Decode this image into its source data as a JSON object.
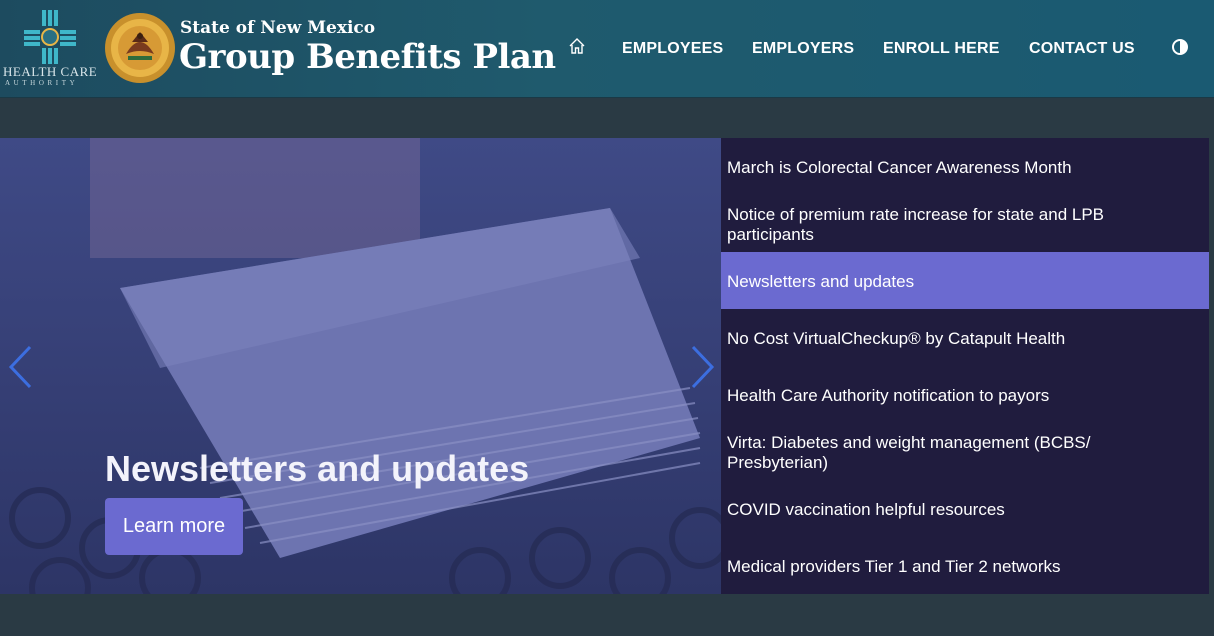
{
  "header": {
    "hca_line1": "HEALTH CARE",
    "hca_line2": "AUTHORITY",
    "title_small": "State of New Mexico",
    "title_big": "Group Benefits Plan",
    "nav": [
      {
        "label": "EMPLOYEES"
      },
      {
        "label": "EMPLOYERS"
      },
      {
        "label": "ENROLL HERE"
      },
      {
        "label": "CONTACT US"
      }
    ],
    "icons": {
      "home": "home-icon",
      "contrast": "contrast-icon"
    }
  },
  "hero": {
    "title": "Newsletters and updates",
    "button": "Learn more"
  },
  "news_list": [
    "March is Colorectal Cancer Awareness Month",
    "Notice of premium rate increase for state and LPB participants",
    "Newsletters and updates",
    "No Cost VirtualCheckup® by Catapult Health",
    "Health Care Authority notification to payors",
    "Virta: Diabetes and weight management (BCBS/ Presbyterian)",
    "COVID vaccination helpful resources",
    "Medical providers Tier 1 and Tier 2 networks"
  ],
  "colors": {
    "accent": "#6b6ad0",
    "list_bg": "#201c3e",
    "page_bg": "#2a3a44"
  }
}
